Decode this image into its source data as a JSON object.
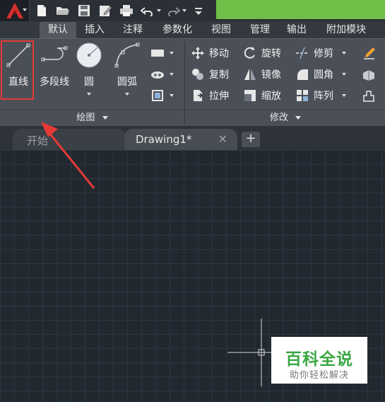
{
  "ribbon": {
    "tabs": [
      "默认",
      "插入",
      "注释",
      "参数化",
      "视图",
      "管理",
      "输出",
      "附加模块"
    ],
    "active_tab": "默认"
  },
  "draw_panel": {
    "title": "绘图",
    "tools": [
      {
        "label": "直线",
        "icon": "line-icon",
        "highlighted": true
      },
      {
        "label": "多段线",
        "icon": "polyline-icon"
      },
      {
        "label": "圆",
        "icon": "circle-icon"
      },
      {
        "label": "圆弧",
        "icon": "arc-icon"
      }
    ]
  },
  "modify_panel": {
    "title": "修改",
    "tools": [
      {
        "label": "移动",
        "icon": "move-icon"
      },
      {
        "label": "旋转",
        "icon": "rotate-icon"
      },
      {
        "label": "修剪",
        "icon": "trim-icon"
      },
      {
        "label": "复制",
        "icon": "copy-icon"
      },
      {
        "label": "镜像",
        "icon": "mirror-icon"
      },
      {
        "label": "圆角",
        "icon": "fillet-icon"
      },
      {
        "label": "拉伸",
        "icon": "stretch-icon"
      },
      {
        "label": "缩放",
        "icon": "scale-icon"
      },
      {
        "label": "阵列",
        "icon": "array-icon"
      }
    ]
  },
  "document_tabs": {
    "start": "开始",
    "drawing": "Drawing1*"
  },
  "watermark": {
    "title": "百科全说",
    "subtitle": "助你轻松解决"
  },
  "colors": {
    "title_accent": "#6fbe47",
    "highlight": "#e53935",
    "watermark_green": "#3aa844"
  }
}
